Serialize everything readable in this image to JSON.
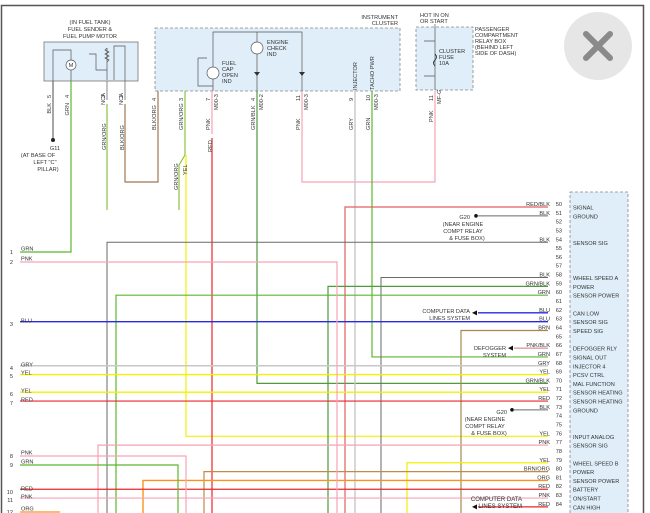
{
  "wire_colors": {
    "GRN": "#5cb82e",
    "PNK": "#f5a3b6",
    "BLU": "#2a2ae0",
    "GRY": "#c8c8c8",
    "YEL": "#f4f000",
    "RED": "#e8262b",
    "ORG": "#f7941d",
    "BLK": "#6a6a6a",
    "BRN": "#a8884a",
    "GRN/BLK": "#4e9a3c",
    "RED/BLK": "#e06060",
    "PNK/BLK": "#d07484",
    "BRN/ORG": "#c08a48",
    "GRN/ORG": "#8cc040",
    "BLK/ORG": "#a07850"
  },
  "fuel_pump": {
    "title": [
      "(IN FUEL TANK)",
      "FUEL SENDER &",
      "FUEL PUMP MOTOR"
    ],
    "motor_symbol": "M",
    "pins": [
      {
        "num": "5",
        "wire": "BLK"
      },
      {
        "num": "4",
        "wire": "GRN"
      },
      {
        "num": "3",
        "wire": "NCA"
      },
      {
        "num": "1",
        "wire": "NCA"
      }
    ],
    "lower_wires": [
      "GRN/ORG",
      "BLK/ORG"
    ]
  },
  "ground_g11": {
    "name": "G11",
    "location": [
      "(AT BASE OF",
      "LEFT \"C\"",
      "PILLAR)"
    ]
  },
  "cluster": {
    "title": [
      "INSTRUMENT",
      "CLUSTER"
    ],
    "fuel_cap": [
      "FUEL",
      "CAP",
      "OPEN",
      "IND"
    ],
    "engine_check": [
      "ENGINE",
      "CHECK",
      "IND"
    ],
    "injector_label": "INJECTOR",
    "tacho_label": "TACHO PWR",
    "pins": [
      {
        "num": "4",
        "wire": "BLK/ORG",
        "conn": ""
      },
      {
        "num": "3",
        "wire": "GRN/ORG",
        "conn": ""
      },
      {
        "num": "7",
        "wire": "PNK",
        "conn": "M00-3"
      },
      {
        "num": "4",
        "wire": "GRN/BLK",
        "conn": "M00-2"
      },
      {
        "num": "11",
        "wire": "PNK",
        "conn": "M00-3"
      },
      {
        "num": "9",
        "wire": "GRY",
        "conn": ""
      },
      {
        "num": "10",
        "wire": "GRN",
        "conn": "M00-3"
      }
    ],
    "split_wires": [
      "GRN/ORG",
      "YEL"
    ],
    "red_below": "RED"
  },
  "relay_box": {
    "hot_label": [
      "HOT IN ON",
      "OR START"
    ],
    "title": [
      "PASSENGER",
      "COMPARTMENT",
      "RELAY BOX",
      "(BEHIND LEFT",
      "SIDE OF DASH)"
    ],
    "fuse": [
      "CLUSTER",
      "FUSE",
      "10A"
    ],
    "pin": {
      "num": "11",
      "wire": "PNK",
      "conn": "MF-G"
    }
  },
  "left_pins": [
    {
      "num": "1",
      "wire": "GRN"
    },
    {
      "num": "2",
      "wire": "PNK"
    },
    {
      "num": "3",
      "wire": "BLU"
    },
    {
      "num": "4",
      "wire": "GRY"
    },
    {
      "num": "5",
      "wire": "YEL"
    },
    {
      "num": "6",
      "wire": "YEL"
    },
    {
      "num": "7",
      "wire": "RED"
    },
    {
      "num": "8",
      "wire": "PNK"
    },
    {
      "num": "9",
      "wire": "GRN"
    },
    {
      "num": "10",
      "wire": "RED"
    },
    {
      "num": "11",
      "wire": "PNK"
    },
    {
      "num": "12",
      "wire": "ORG"
    }
  ],
  "connector_pins": [
    {
      "pin": "50",
      "wire": "RED/BLK",
      "func": "SIGNAL"
    },
    {
      "pin": "51",
      "wire": "BLK",
      "func": "GROUND"
    },
    {
      "pin": "52",
      "wire": "",
      "func": ""
    },
    {
      "pin": "53",
      "wire": "",
      "func": ""
    },
    {
      "pin": "54",
      "wire": "BLK",
      "func": "SENSOR SIG"
    },
    {
      "pin": "55",
      "wire": "",
      "func": ""
    },
    {
      "pin": "56",
      "wire": "",
      "func": ""
    },
    {
      "pin": "57",
      "wire": "",
      "func": ""
    },
    {
      "pin": "58",
      "wire": "BLK",
      "func": "WHEEL SPEED A"
    },
    {
      "pin": "59",
      "wire": "GRN/BLK",
      "func": "POWER"
    },
    {
      "pin": "60",
      "wire": "GRN",
      "func": "SENSOR POWER"
    },
    {
      "pin": "61",
      "wire": "",
      "func": ""
    },
    {
      "pin": "62",
      "wire": "BLU",
      "func": "CAN LOW"
    },
    {
      "pin": "63",
      "wire": "BLU",
      "func": "SENSOR SIG"
    },
    {
      "pin": "64",
      "wire": "BRN",
      "func": "SPEED SIG"
    },
    {
      "pin": "65",
      "wire": "",
      "func": ""
    },
    {
      "pin": "66",
      "wire": "PNK/BLK",
      "func": "DEFOGGER RLY"
    },
    {
      "pin": "67",
      "wire": "GRN",
      "func": "SIGNAL OUT"
    },
    {
      "pin": "68",
      "wire": "GRY",
      "func": "INJECTOR 4"
    },
    {
      "pin": "69",
      "wire": "YEL",
      "func": "PCSV CTRL"
    },
    {
      "pin": "70",
      "wire": "GRN/BLK",
      "func": "MAL FUNCTION"
    },
    {
      "pin": "71",
      "wire": "YEL",
      "func": "SENSOR HEATING"
    },
    {
      "pin": "72",
      "wire": "RED",
      "func": "SENSOR HEATING"
    },
    {
      "pin": "73",
      "wire": "BLK",
      "func": "GROUND"
    },
    {
      "pin": "74",
      "wire": "",
      "func": ""
    },
    {
      "pin": "75",
      "wire": "",
      "func": ""
    },
    {
      "pin": "76",
      "wire": "YEL",
      "func": "INPUT ANALOG"
    },
    {
      "pin": "77",
      "wire": "PNK",
      "func": "SENSOR SIG"
    },
    {
      "pin": "78",
      "wire": "",
      "func": ""
    },
    {
      "pin": "79",
      "wire": "YEL",
      "func": "WHEEL SPEED B"
    },
    {
      "pin": "80",
      "wire": "BRN/ORG",
      "func": "POWER"
    },
    {
      "pin": "81",
      "wire": "ORG",
      "func": "SENSOR POWER"
    },
    {
      "pin": "82",
      "wire": "RED",
      "func": "BATTERY"
    },
    {
      "pin": "83",
      "wire": "PNK",
      "func": "ON/START"
    },
    {
      "pin": "84",
      "wire": "RED",
      "func": "CAN HIGH"
    }
  ],
  "annotations": {
    "g20_top": {
      "name": "G20",
      "location": [
        "(NEAR ENGINE",
        "COMPT RELAY",
        "& FUSE BOX)"
      ]
    },
    "g20_bottom": {
      "name": "G20",
      "location": [
        "(NEAR ENGINE",
        "COMPT RELAY",
        "& FUSE BOX)"
      ]
    },
    "computer_data_1": [
      "COMPUTER DATA",
      "LINES SYSTEM"
    ],
    "computer_data_2": [
      "COMPUTER DATA",
      "LINES SYSTEM"
    ],
    "defogger": [
      "DEFOGGER",
      "SYSTEM"
    ]
  },
  "close_button": {
    "icon": "close-icon"
  }
}
